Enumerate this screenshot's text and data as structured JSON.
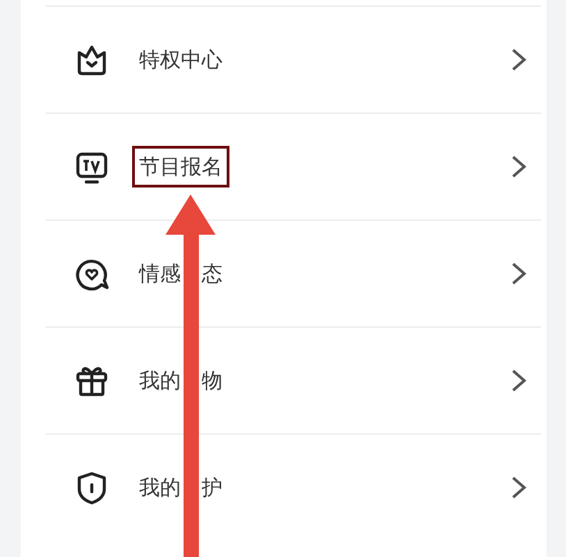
{
  "menu": [
    {
      "label_parts": [
        "特权中心"
      ],
      "highlighted": false
    },
    {
      "label_parts": [
        "节目报名"
      ],
      "highlighted": true
    },
    {
      "label_parts": [
        "情感",
        "态"
      ],
      "highlighted": false
    },
    {
      "label_parts": [
        "我的",
        "物"
      ],
      "highlighted": false
    },
    {
      "label_parts": [
        "我的",
        "护"
      ],
      "highlighted": false
    }
  ]
}
